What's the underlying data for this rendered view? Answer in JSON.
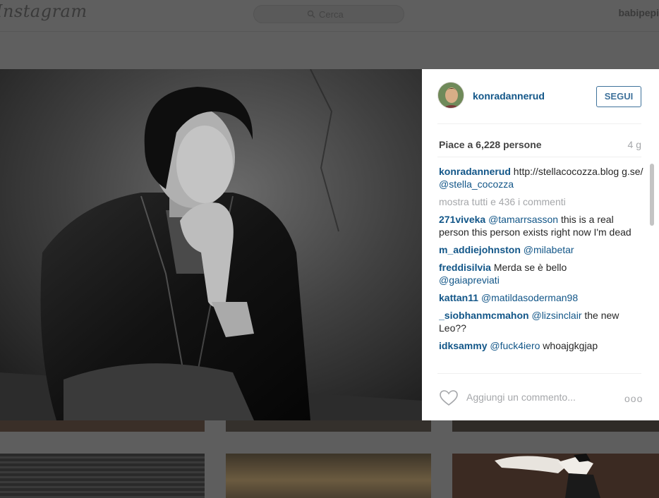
{
  "app": {
    "logo": "Instagram",
    "search_placeholder": "Cerca",
    "username": "babipepi"
  },
  "post": {
    "author": "konradannerud",
    "follow_label": "SEGUI",
    "likes": "Piace a 6,228 persone",
    "age": "4 g",
    "caption": {
      "user": "konradannerud",
      "text": "http://stellacocozza.blog g.se/",
      "tag": "@stella_cocozza"
    },
    "show_all_comments": "mostra tutti e 436 i commenti",
    "comments": [
      {
        "user": "271viveka",
        "tag": "@tamarrsasson",
        "text": " this is a real person this person exists right now I'm dead"
      },
      {
        "user": "m_addiejohnston",
        "tag": "@milabetar",
        "text": ""
      },
      {
        "user": "freddisilvia",
        "tag": "",
        "text": "Merda se è bello"
      },
      {
        "user": "kattan11",
        "tag": "@matildasoderman98",
        "text": ""
      },
      {
        "user": "_siobhanmcmahon",
        "tag": "@lizsinclair",
        "text": " the new Leo??"
      },
      {
        "user": "idksammy",
        "tag": "@fuck4iero",
        "text": " whoajgkgjap"
      }
    ],
    "comments_extra_tag": "@gaiapreviati",
    "add_comment_placeholder": "Aggiungi un commento...",
    "more_options": "ooo"
  },
  "icons": {
    "search": "search-icon",
    "like": "heart-outline-icon",
    "options": "more-options-icon"
  },
  "colors": {
    "link_blue": "#125688",
    "follow_blue": "#3f729b",
    "muted_gray": "#a5a7aa"
  }
}
